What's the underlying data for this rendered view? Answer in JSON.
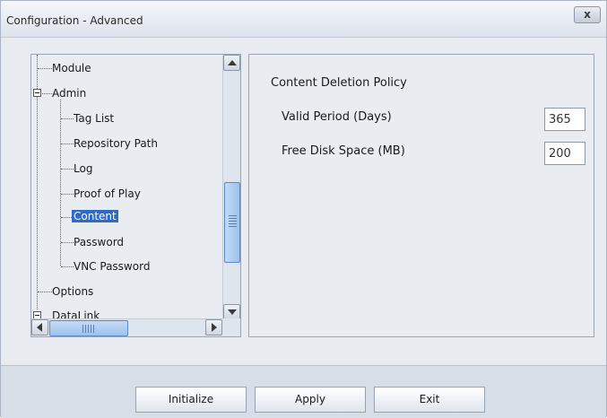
{
  "window": {
    "title": "Configuration - Advanced",
    "close_glyph": "x"
  },
  "tree": {
    "items": [
      {
        "label": "Module"
      },
      {
        "label": "Admin"
      },
      {
        "label": "Tag List"
      },
      {
        "label": "Repository Path"
      },
      {
        "label": "Log"
      },
      {
        "label": "Proof of Play"
      },
      {
        "label": "Content"
      },
      {
        "label": "Password"
      },
      {
        "label": "VNC Password"
      },
      {
        "label": "Options"
      },
      {
        "label": "DataLink"
      }
    ],
    "selected": "Content"
  },
  "policy": {
    "title": "Content Deletion Policy",
    "valid_period_label": "Valid Period (Days)",
    "valid_period_value": "365",
    "free_disk_label": "Free Disk Space (MB)",
    "free_disk_value": "200"
  },
  "buttons": {
    "initialize": "Initialize",
    "apply": "Apply",
    "exit": "Exit"
  },
  "colors": {
    "selection": "#3169c6",
    "scroll_thumb": "#9cc2ee"
  }
}
